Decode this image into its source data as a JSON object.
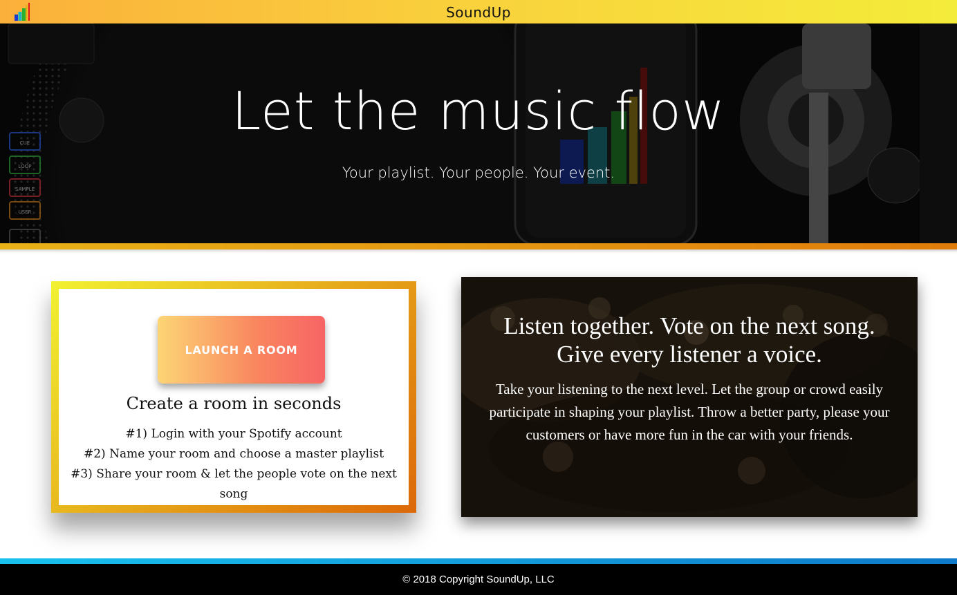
{
  "header": {
    "app_name": "SoundUp",
    "logo_icon": "bar-chart-logo-icon"
  },
  "hero": {
    "title": "Let the music flow",
    "subtitle": "Your playlist. Your people. Your event.",
    "turntable_labels": [
      "CUE",
      "LOOP",
      "SAMPLE",
      "USER"
    ]
  },
  "room_card": {
    "button_label": "LAUNCH A ROOM",
    "heading": "Create a room in seconds",
    "steps": [
      "#1) Login with your Spotify account",
      "#2) Name your room and choose a master playlist",
      "#3) Share your room & let the people vote on the next song"
    ]
  },
  "info_card": {
    "headline_line1": "Listen together. Vote on the next song.",
    "headline_line2": "Give every listener a voice.",
    "body": "Take your listening to the next level. Let the group or crowd easily participate in shaping your playlist. Throw a better party, please your customers or have more fun in the car with your friends."
  },
  "footer": {
    "copyright": "© 2018 Copyright SoundUp, LLC"
  },
  "colors": {
    "topbar_gradient": [
      "#fbb03b",
      "#f4ec3a"
    ],
    "hero_stripe": [
      "#e9b217",
      "#e07c0a"
    ],
    "footer_stripe": [
      "#19c1ee",
      "#0e7ac9"
    ],
    "button_gradient": [
      "#fdd575",
      "#f86465"
    ]
  }
}
